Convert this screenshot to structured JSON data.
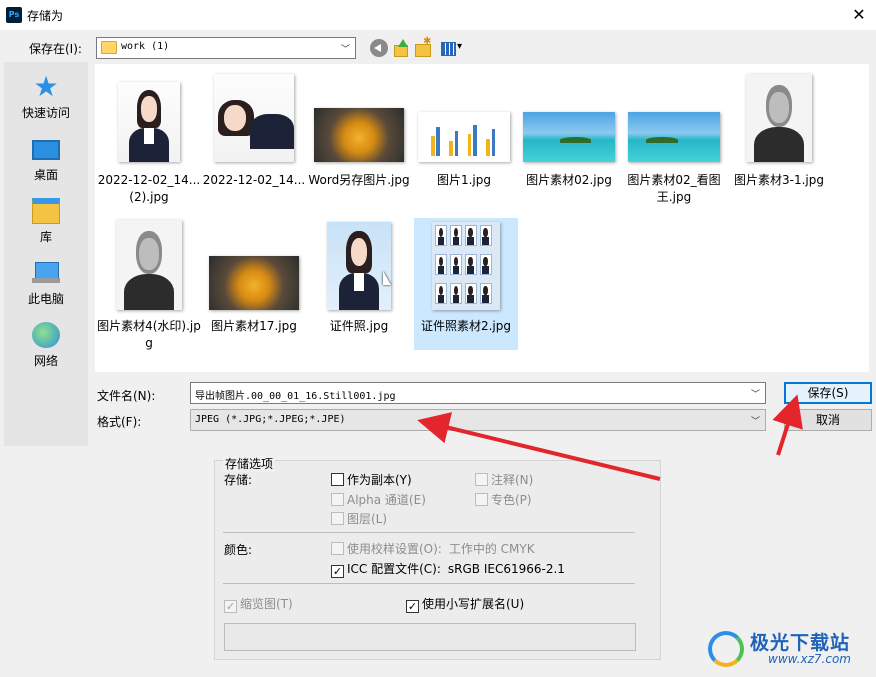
{
  "window": {
    "app_icon": "Ps",
    "title": "存储为",
    "close_glyph": "✕"
  },
  "save_in": {
    "label": "保存在(I):",
    "folder": "work (1)"
  },
  "places": [
    {
      "label": "快速访问",
      "icon": "star-icon"
    },
    {
      "label": "桌面",
      "icon": "desktop-icon"
    },
    {
      "label": "库",
      "icon": "library-icon"
    },
    {
      "label": "此电脑",
      "icon": "pc-icon"
    },
    {
      "label": "网络",
      "icon": "network-icon"
    }
  ],
  "files": [
    {
      "name": "2022-12-02_14...(2).jpg",
      "kind": "photo-girl"
    },
    {
      "name": "2022-12-02_14...",
      "kind": "photo-girl"
    },
    {
      "name": "Word另存图片.jpg",
      "kind": "leaf"
    },
    {
      "name": "图片1.jpg",
      "kind": "chart"
    },
    {
      "name": "图片素材02.jpg",
      "kind": "sea"
    },
    {
      "name": "图片素材02_看图王.jpg",
      "kind": "sea"
    },
    {
      "name": "图片素材3-1.jpg",
      "kind": "old-man"
    },
    {
      "name": "图片素材4(水印).jpg",
      "kind": "old-man"
    },
    {
      "name": "图片素材17.jpg",
      "kind": "leaf"
    },
    {
      "name": "证件照.jpg",
      "kind": "photo-girl"
    },
    {
      "name": "证件照素材2.jpg",
      "kind": "photo-sheet",
      "selected": true
    }
  ],
  "filename": {
    "label": "文件名(N):",
    "value": "导出帧图片.00_00_01_16.Still001.jpg"
  },
  "format": {
    "label": "格式(F):",
    "value": "JPEG (*.JPG;*.JPEG;*.JPE)"
  },
  "buttons": {
    "save": "保存(S)",
    "cancel": "取消"
  },
  "options": {
    "group_title": "存储选项",
    "storage_label": "存储:",
    "as_copy": "作为副本(Y)",
    "annotations": "注释(N)",
    "alpha": "Alpha 通道(E)",
    "spot": "专色(P)",
    "layers": "图层(L)",
    "color_label": "颜色:",
    "proof": "使用校样设置(O):",
    "proof_value": "工作中的 CMYK",
    "icc": "ICC 配置文件(C):",
    "icc_value": "sRGB IEC61966-2.1",
    "thumbnail": "缩览图(T)",
    "lowercase": "使用小写扩展名(U)",
    "check_glyph": "✓"
  },
  "watermark": {
    "main": "极光下载站",
    "url": "www.xz7.com"
  },
  "colors": {
    "annotation_arrow": "#e3262b",
    "accent": "#0078d7",
    "selection": "#cce8ff"
  }
}
